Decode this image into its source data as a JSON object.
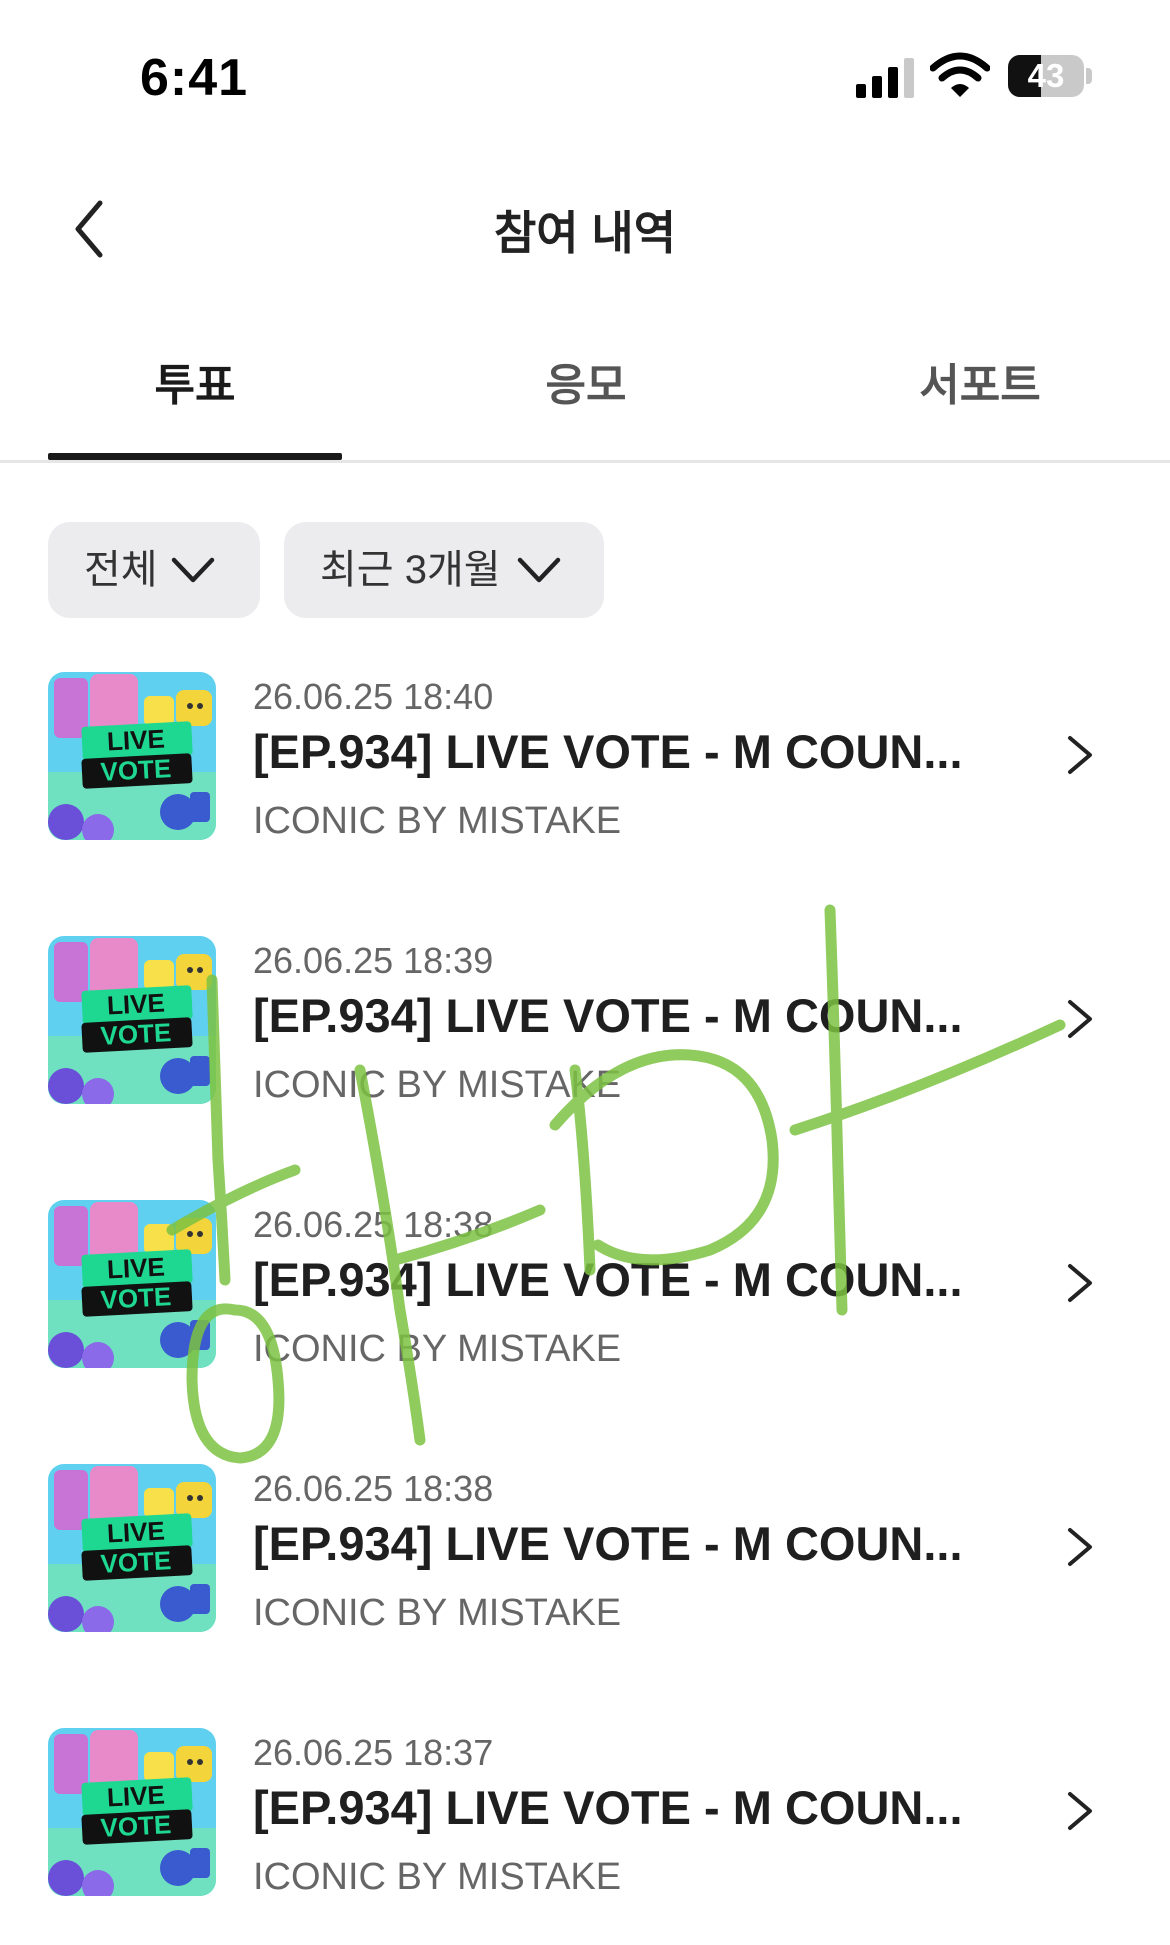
{
  "status_bar": {
    "time": "6:41",
    "battery": "43",
    "battery_level": 0.43,
    "icons": [
      "signal-icon",
      "wifi-icon",
      "battery-icon"
    ]
  },
  "header": {
    "title": "참여 내역",
    "back_icon": "chevron-left-icon"
  },
  "tabs": [
    {
      "label": "투표",
      "active": true
    },
    {
      "label": "응모",
      "active": false
    },
    {
      "label": "서포트",
      "active": false
    }
  ],
  "filters": [
    {
      "label": "전체"
    },
    {
      "label": "최근 3개월"
    }
  ],
  "items": [
    {
      "date": "26.06.25 18:40",
      "title": "[EP.934] LIVE VOTE - M COUN...",
      "subtitle": "ICONIC BY MISTAKE",
      "thumb_line1": "LIVE",
      "thumb_line2": "VOTE"
    },
    {
      "date": "26.06.25 18:39",
      "title": "[EP.934] LIVE VOTE - M COUN...",
      "subtitle": "ICONIC BY MISTAKE",
      "thumb_line1": "LIVE",
      "thumb_line2": "VOTE"
    },
    {
      "date": "26.06.25 18:38",
      "title": "[EP.934] LIVE VOTE - M COUN...",
      "subtitle": "ICONIC BY MISTAKE",
      "thumb_line1": "LIVE",
      "thumb_line2": "VOTE"
    },
    {
      "date": "26.06.25 18:38",
      "title": "[EP.934] LIVE VOTE - M COUN...",
      "subtitle": "ICONIC BY MISTAKE",
      "thumb_line1": "LIVE",
      "thumb_line2": "VOTE"
    },
    {
      "date": "26.06.25 18:37",
      "title": "[EP.934] LIVE VOTE - M COUN...",
      "subtitle": "ICONIC BY MISTAKE",
      "thumb_line1": "LIVE",
      "thumb_line2": "VOTE"
    }
  ],
  "overlay": {
    "handwriting": "하마",
    "color": "#7cc242"
  },
  "colors": {
    "text": "#1a1a1a",
    "secondary_text": "#666666",
    "chip_background": "#ececef",
    "thumb_background": "#5fd0f0"
  }
}
